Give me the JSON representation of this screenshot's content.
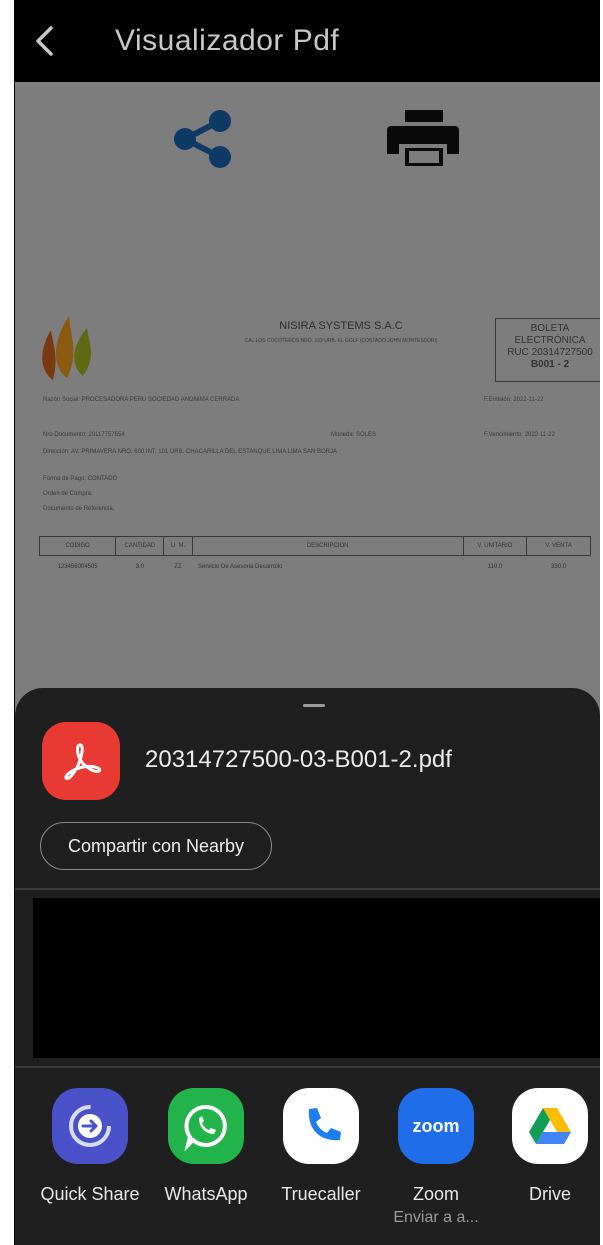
{
  "appbar": {
    "title": "Visualizador Pdf"
  },
  "pdf": {
    "company_name": "NISIRA SYSTEMS S.A.C",
    "company_address": "CAL.LOS COCOTEROS NRO. 163 URB. EL GOLF (COSTADO JOHN MONTESSORI)",
    "boleta_line1": "BOLETA",
    "boleta_line2": "ELECTRÓNICA",
    "boleta_ruc": "RUC 20314727500",
    "boleta_number": "B001 - 2",
    "razon_social": "Razón Social: PROCESADORA PERU SOCIEDAD ANONIMA CERRADA",
    "fecha_emision": "F.Emisión: 2022-11-22",
    "nro_documento": "Nro Documento: 20117757554",
    "moneda": "Moneda: SOLES",
    "fecha_vencimiento": "F.Vencimiento: 2022-11-22",
    "direccion": "Dirección: AV. PRIMAVERA NRO. 600 INT. 101 URB. CHACARILLA DEL ESTANQUE LIMA LIMA SAN BORJA",
    "forma_pago": "Forma de Pago: CONTADO",
    "orden_compra": "Orden de Compra:",
    "documento_referencia": "Documento de Referencia:",
    "table_headers": [
      "CODIGO",
      "CANTIDAD",
      "U. M.",
      "DESCRIPCION",
      "V. UNITARIO",
      "V. VENTA"
    ],
    "table_rows": [
      [
        "123456004505",
        "3.0",
        "ZZ",
        "Servicio De Asesoria Desarrollo",
        "110.0",
        "330.0"
      ]
    ]
  },
  "sheet": {
    "file_name": "20314727500-03-B001-2.pdf",
    "nearby_label": "Compartir con Nearby",
    "apps": [
      {
        "label": "Quick Share",
        "icon": "quick-share-icon",
        "color": "#4a52c9",
        "sub": ""
      },
      {
        "label": "WhatsApp",
        "icon": "whatsapp-icon",
        "color": "#22b34a",
        "sub": ""
      },
      {
        "label": "Truecaller",
        "icon": "phone-icon",
        "color": "#ffffff",
        "sub": ""
      },
      {
        "label": "Zoom",
        "icon": "zoom-icon",
        "color": "#1f6de8",
        "sub": "Enviar a a...",
        "icon_text": "zoom"
      },
      {
        "label": "Drive",
        "icon": "drive-icon",
        "color": "#ffffff",
        "sub": ""
      }
    ]
  }
}
